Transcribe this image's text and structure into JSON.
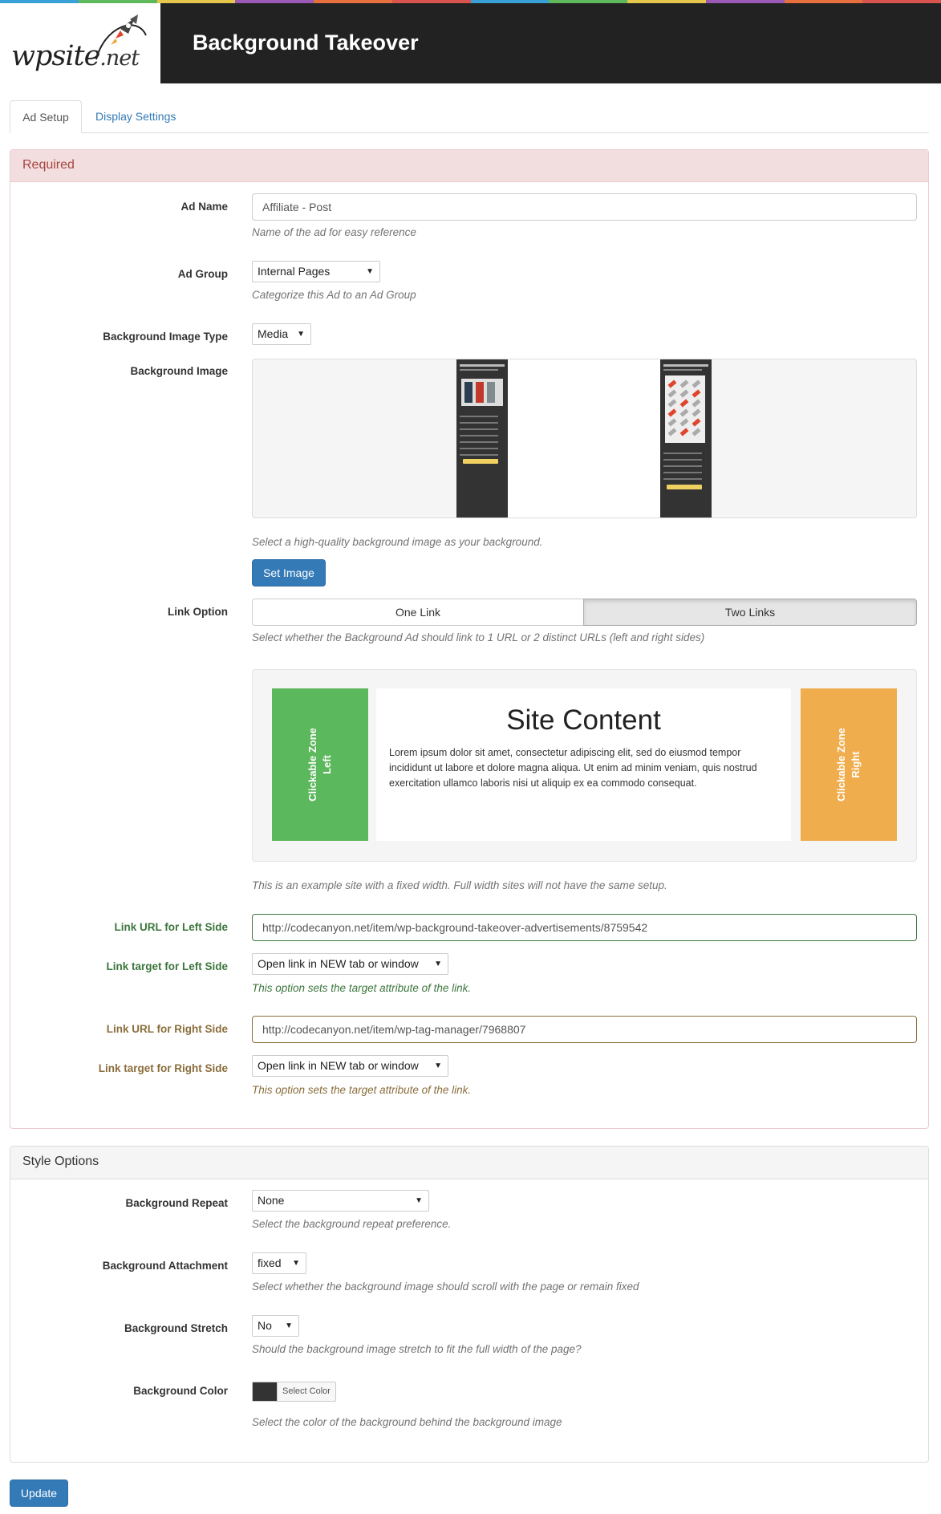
{
  "header": {
    "title": "Background Takeover",
    "logo_text": "wpsite",
    "logo_suffix": ".net",
    "rainbow_colors": [
      "#3aa0d8",
      "#5fb85c",
      "#e5c84b",
      "#9b59b6",
      "#e56f3d",
      "#d9534f",
      "#3aa0d8",
      "#5fb85c",
      "#e5c84b",
      "#9b59b6",
      "#e56f3d",
      "#d9534f"
    ]
  },
  "tabs": [
    {
      "label": "Ad Setup",
      "active": true
    },
    {
      "label": "Display Settings",
      "active": false
    }
  ],
  "required": {
    "heading": "Required",
    "ad_name": {
      "label": "Ad Name",
      "value": "Affiliate - Post",
      "help": "Name of the ad for easy reference"
    },
    "ad_group": {
      "label": "Ad Group",
      "value": "Internal Pages",
      "help": "Categorize this Ad to an Ad Group"
    },
    "bg_image_type": {
      "label": "Background Image Type",
      "value": "Media"
    },
    "bg_image": {
      "label": "Background Image",
      "help": "Select a high-quality background image as your background.",
      "button": "Set Image",
      "left_thumb_title": "Background Takeover",
      "right_thumb_title": "WP Tag Manager"
    },
    "link_option": {
      "label": "Link Option",
      "options": [
        "One Link",
        "Two Links"
      ],
      "selected": "Two Links",
      "help": "Select whether the Background Ad should link to 1 URL or 2 distinct URLs (left and right sides)"
    },
    "example": {
      "left_zone": "Clickable Zone\nLeft",
      "right_zone": "Clickable Zone\nRight",
      "title": "Site Content",
      "body": "Lorem ipsum dolor sit amet, consectetur adipiscing elit, sed do eiusmod tempor incididunt ut labore et dolore magna aliqua. Ut enim ad minim veniam, quis nostrud exercitation ullamco laboris nisi ut aliquip ex ea commodo consequat.",
      "help": "This is an example site with a fixed width. Full width sites will not have the same setup.",
      "left_color": "#5cb85c",
      "right_color": "#f0ad4e"
    },
    "left_url": {
      "label": "Link URL for Left Side",
      "value": "http://codecanyon.net/item/wp-background-takeover-advertisements/8759542"
    },
    "left_target": {
      "label": "Link target for Left Side",
      "value": "Open link in NEW tab or window",
      "help": "This option sets the target attribute of the link."
    },
    "right_url": {
      "label": "Link URL for Right Side",
      "value": "http://codecanyon.net/item/wp-tag-manager/7968807"
    },
    "right_target": {
      "label": "Link target for Right Side",
      "value": "Open link in NEW tab or window",
      "help": "This option sets the target attribute of the link."
    }
  },
  "style": {
    "heading": "Style Options",
    "repeat": {
      "label": "Background Repeat",
      "value": "None",
      "help": "Select the background repeat preference."
    },
    "attachment": {
      "label": "Background Attachment",
      "value": "fixed",
      "help": "Select whether the background image should scroll with the page or remain fixed"
    },
    "stretch": {
      "label": "Background Stretch",
      "value": "No",
      "help": "Should the background image stretch to fit the full width of the page?"
    },
    "color": {
      "label": "Background Color",
      "button": "Select Color",
      "value": "#333333",
      "help": "Select the color of the background behind the background image"
    }
  },
  "update_button": "Update"
}
